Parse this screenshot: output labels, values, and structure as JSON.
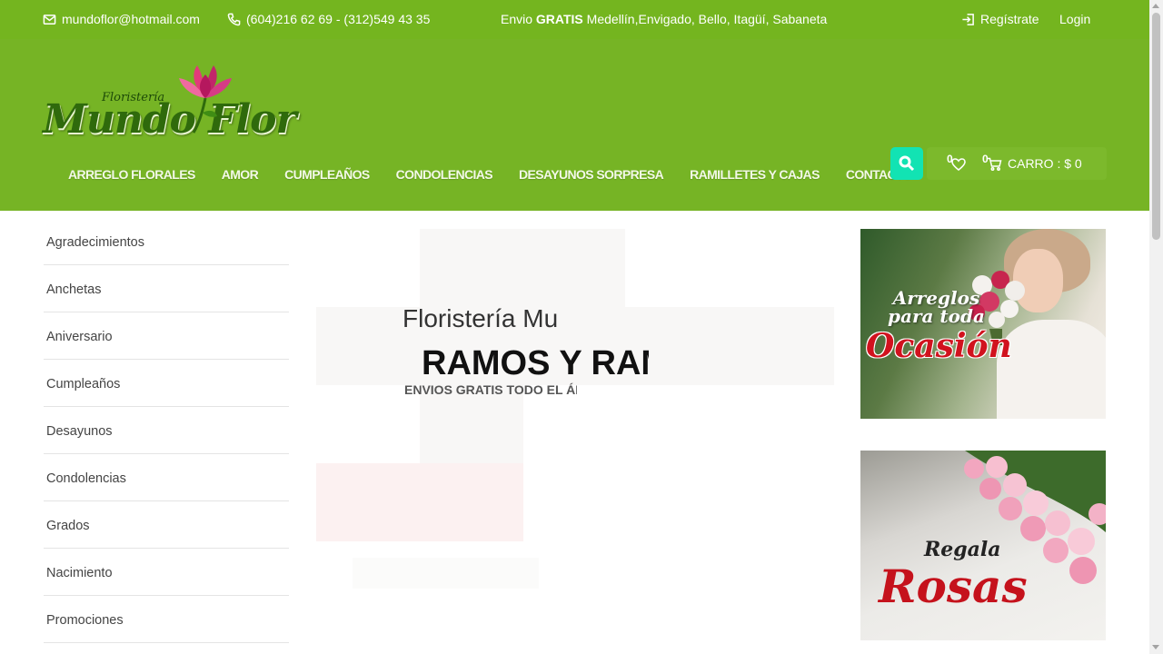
{
  "topbar": {
    "email": "mundoflor@hotmail.com",
    "phones": "(604)216 62 69 - (312)549 43 35",
    "shipping_prefix": "Envio ",
    "shipping_bold": "GRATIS",
    "shipping_suffix": " Medellín,Envigado, Bello, Itagüí, Sabaneta",
    "register": "Regístrate",
    "login": "Login",
    "icons": [
      "mail-icon",
      "phone-icon",
      "login-arrow-icon"
    ]
  },
  "logo": {
    "small": "Floristería",
    "main": "Mundo Flor"
  },
  "nav": [
    "ARREGLO FLORALES",
    "AMOR",
    "CUMPLEAÑOS",
    "CONDOLENCIAS",
    "DESAYUNOS SORPRESA",
    "RAMILLETES Y CAJAS",
    "CONTACTO"
  ],
  "cart": {
    "wish_count": "0",
    "cart_count": "0",
    "label": "CARRO : $ 0"
  },
  "sidebar": [
    "Agradecimientos",
    "Anchetas",
    "Aniversario",
    "Cumpleaños",
    "Desayunos",
    "Condolencias",
    "Grados",
    "Nacimiento",
    "Promociones"
  ],
  "slider": {
    "line1": "Floristería Mundo Flor",
    "line2": "RAMOS Y RAMILLETES",
    "line3": "ENVIOS GRATIS TODO EL ÁREA METROPOLITANA"
  },
  "banners": {
    "b1_small_1": "Arreglos",
    "b1_small_2": "para toda",
    "b1_big": "Ocasión",
    "b2_small": "Regala",
    "b2_big": "Rosas"
  },
  "colors": {
    "brand_green": "#76b425",
    "topbar_green": "#74b51f",
    "search_teal": "#12e3b3",
    "banner_red": "#d1121e"
  }
}
